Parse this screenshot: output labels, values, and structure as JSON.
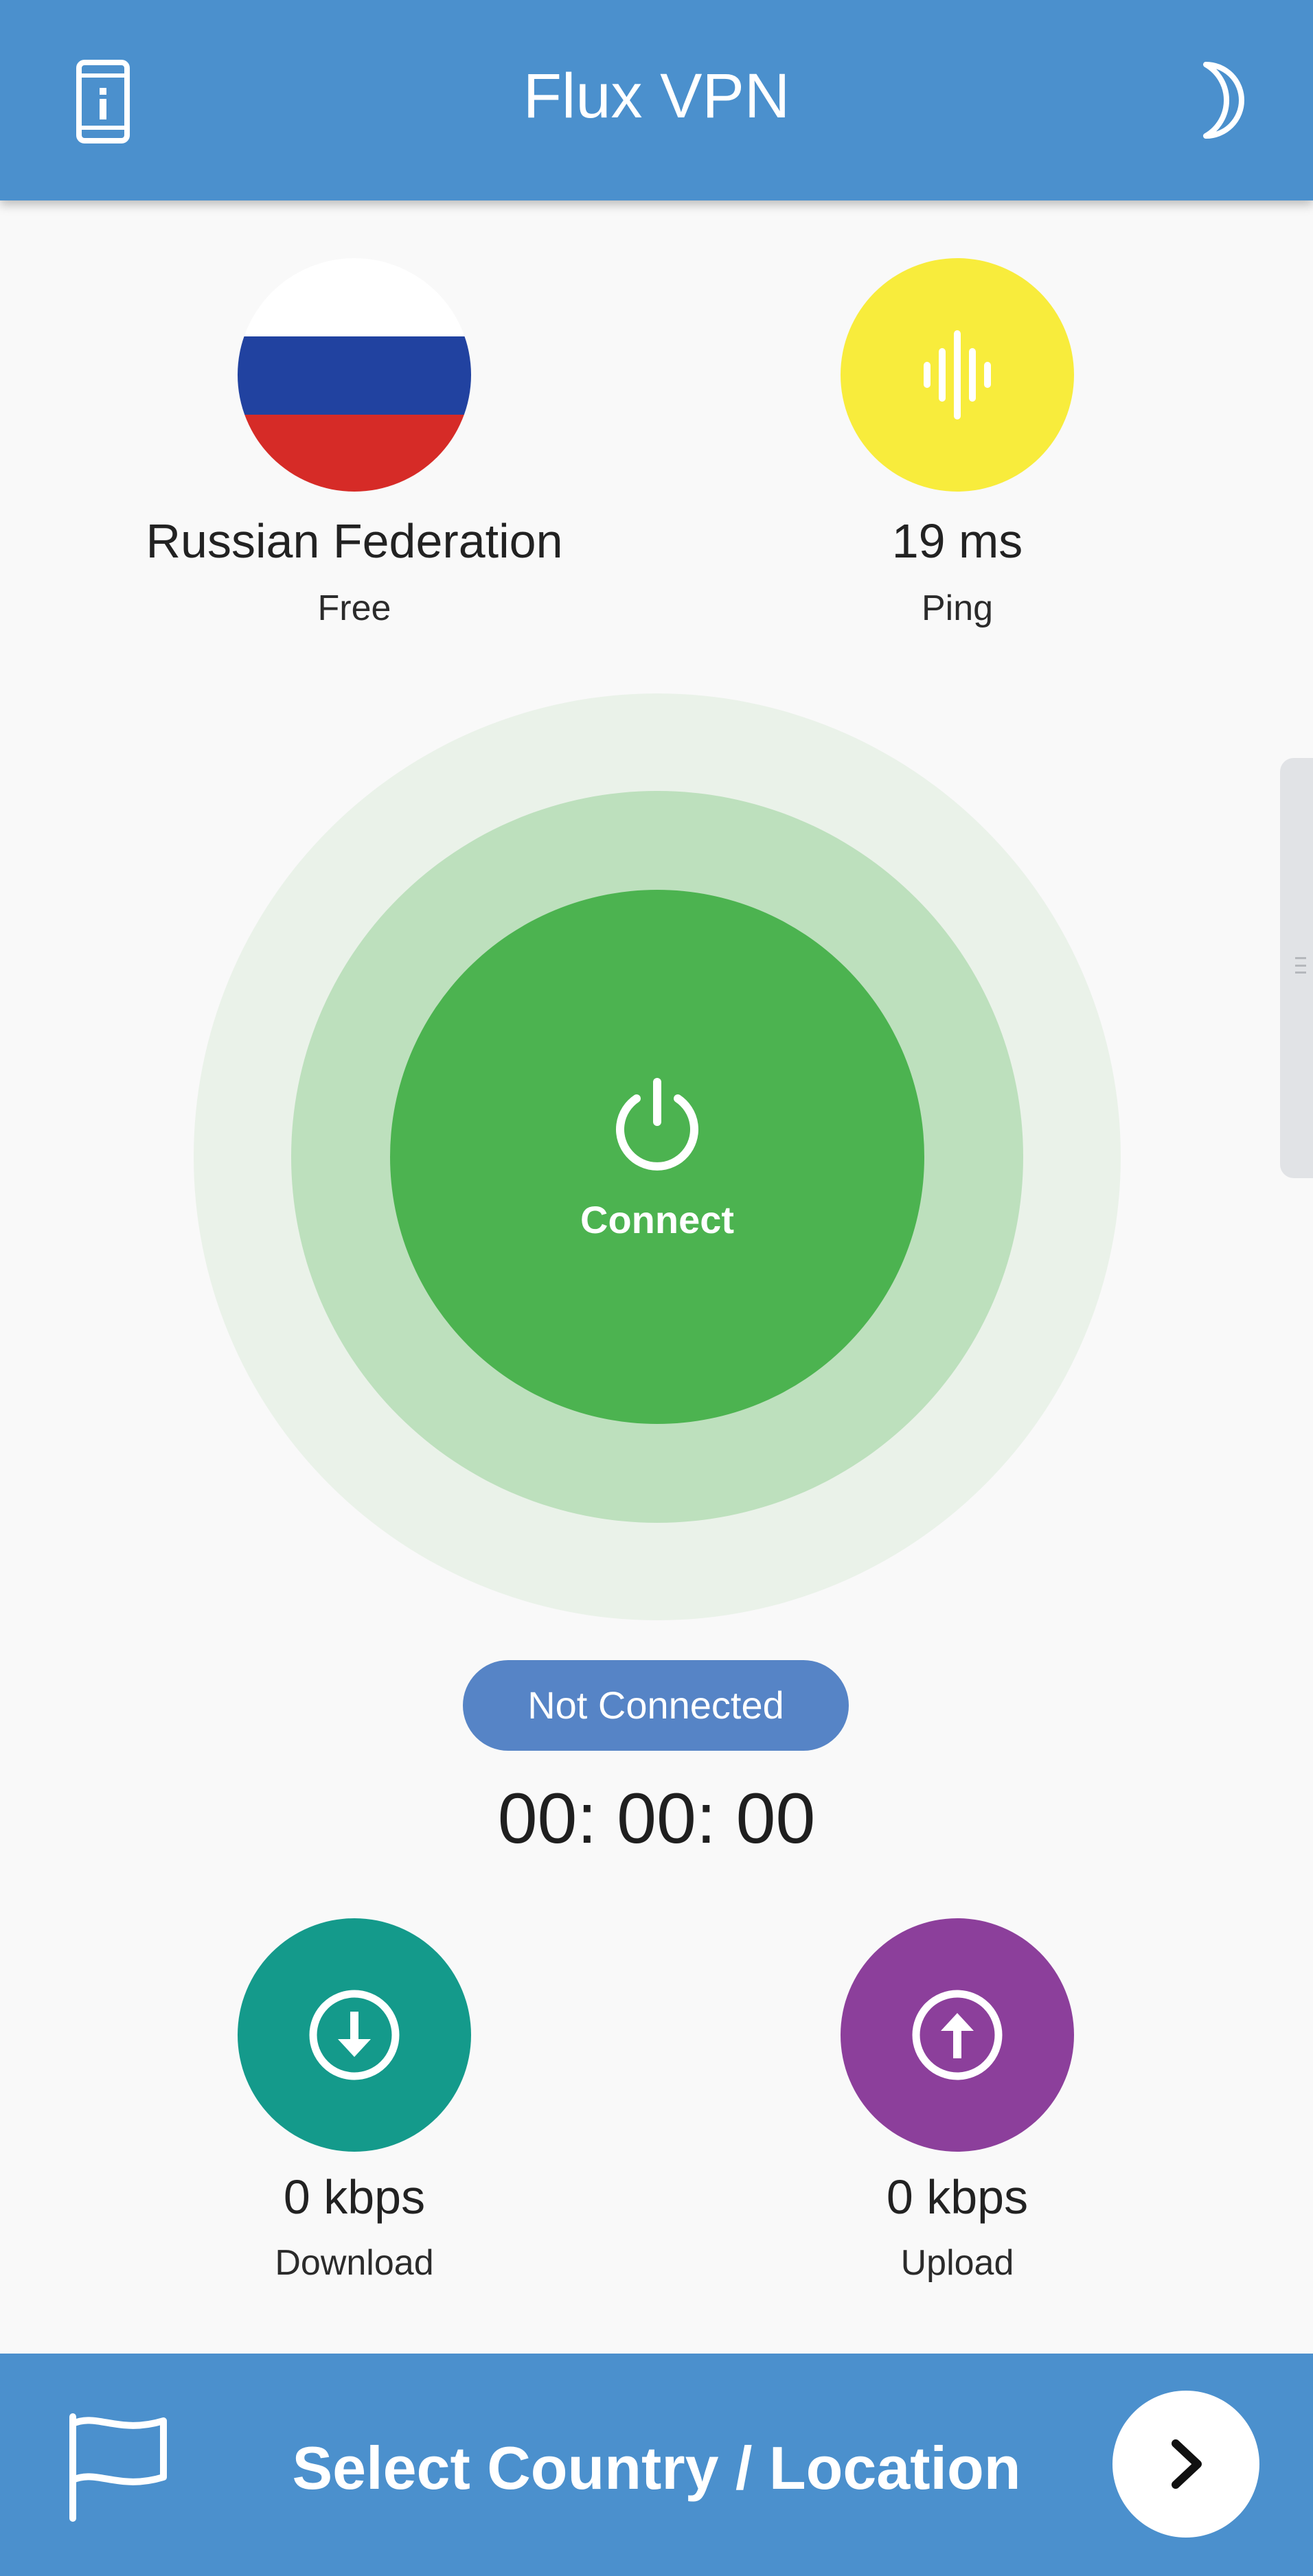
{
  "header": {
    "title": "Flux VPN",
    "left_icon": "device-info-icon",
    "right_icon": "moon-icon"
  },
  "server": {
    "country": "Russian Federation",
    "tier": "Free",
    "flag_icon": "russia-flag-icon"
  },
  "ping": {
    "value": "19 ms",
    "label": "Ping",
    "icon": "sound-wave-icon"
  },
  "connect": {
    "label": "Connect",
    "icon": "power-icon"
  },
  "status": {
    "text": "Not Connected",
    "timer": "00: 00: 00"
  },
  "download": {
    "value": "0 kbps",
    "label": "Download",
    "icon": "download-arrow-icon"
  },
  "upload": {
    "value": "0 kbps",
    "label": "Upload",
    "icon": "upload-arrow-icon"
  },
  "bottom_bar": {
    "label": "Select Country / Location",
    "left_icon": "flag-icon",
    "right_icon": "chevron-right-icon"
  },
  "colors": {
    "primary": "#4b90cd",
    "connect_green": "#4cb350",
    "ping_yellow": "#f8ec3c",
    "download_teal": "#149a8b",
    "upload_purple": "#8c3f9b",
    "status_blue": "#5684c6"
  }
}
